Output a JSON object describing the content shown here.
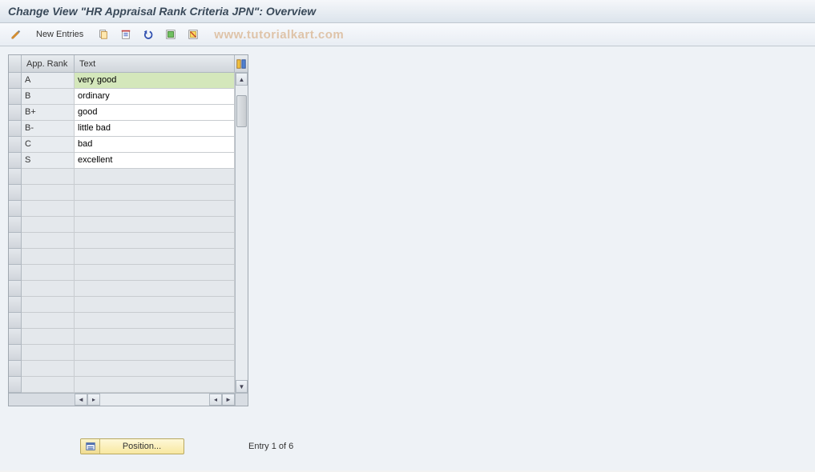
{
  "title": "Change View \"HR Appraisal Rank Criteria JPN\": Overview",
  "toolbar": {
    "new_entries_label": "New Entries"
  },
  "watermark": "www.tutorialkart.com",
  "table": {
    "columns": {
      "rank": "App. Rank",
      "text": "Text"
    },
    "rows": [
      {
        "rank": "A",
        "text": "very good",
        "selected": true
      },
      {
        "rank": "B",
        "text": "ordinary",
        "selected": false
      },
      {
        "rank": "B+",
        "text": "good",
        "selected": false
      },
      {
        "rank": "B-",
        "text": "little bad",
        "selected": false
      },
      {
        "rank": "C",
        "text": "bad",
        "selected": false
      },
      {
        "rank": "S",
        "text": "excellent",
        "selected": false
      }
    ],
    "empty_rows": 14
  },
  "footer": {
    "position_label": "Position...",
    "entry_status": "Entry 1 of 6"
  }
}
